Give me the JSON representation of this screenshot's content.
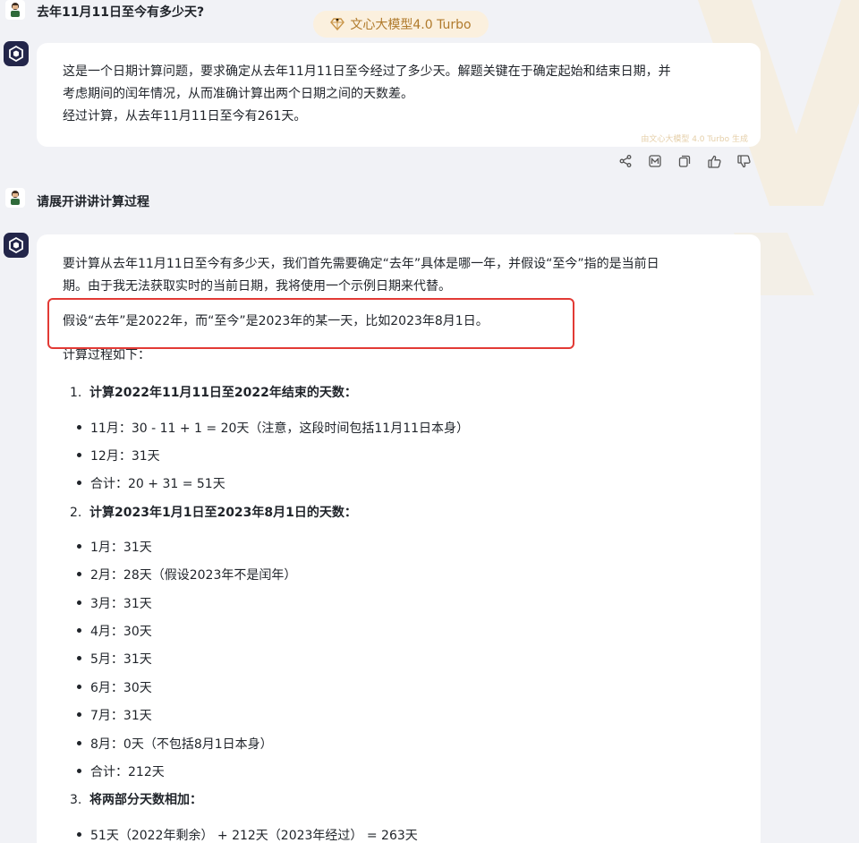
{
  "model_pill": {
    "label": "文心大模型4.0 Turbo"
  },
  "turn1": {
    "question": "去年11月11日至今有多少天?",
    "answer": {
      "line1": "这是一个日期计算问题，要求确定从去年11月11日至今经过了多少天。解题关键在于确定起始和结束日期，并",
      "line2": "考虑期间的闰年情况，从而准确计算出两个日期之间的天数差。",
      "line3": "经过计算，从去年11月11日至今有261天。",
      "generated_note": "由文心大模型 4.0 Turbo 生成"
    }
  },
  "actions": [
    "share-icon",
    "report-icon",
    "copy-icon",
    "thumbs-up-icon",
    "thumbs-down-icon"
  ],
  "turn2": {
    "question": "请展开讲讲计算过程",
    "answer": {
      "intro1": "要计算从去年11月11日至今有多少天，我们首先需要确定“去年”具体是哪一年，并假设“至今”指的是当前日",
      "intro2": "期。由于我无法获取实时的当前日期，我将使用一个示例日期来代替。",
      "assumption": "假设“去年”是2022年，而“至今”是2023年的某一天，比如2023年8月1日。",
      "process_intro": "计算过程如下：",
      "steps": [
        {
          "num": "1.",
          "title": "计算2022年11月11日至2022年结束的天数：",
          "items": [
            "11月：30 - 11 + 1 = 20天（注意，这段时间包括11月11日本身）",
            "12月：31天",
            "合计：20 + 31 = 51天"
          ]
        },
        {
          "num": "2.",
          "title": "计算2023年1月1日至2023年8月1日的天数：",
          "items": [
            "1月：31天",
            "2月：28天（假设2023年不是闰年）",
            "3月：31天",
            "4月：30天",
            "5月：31天",
            "6月：30天",
            "7月：31天",
            "8月：0天（不包括8月1日本身）",
            "合计：212天"
          ]
        },
        {
          "num": "3.",
          "title": "将两部分天数相加：",
          "items": [
            "51天（2022年剩余） + 212天（2023年经过） = 263天"
          ]
        }
      ]
    }
  },
  "colors": {
    "highlight_border": "#e23a35",
    "accent_gold": "#b07a2c",
    "bot_avatar": "#23264a"
  }
}
